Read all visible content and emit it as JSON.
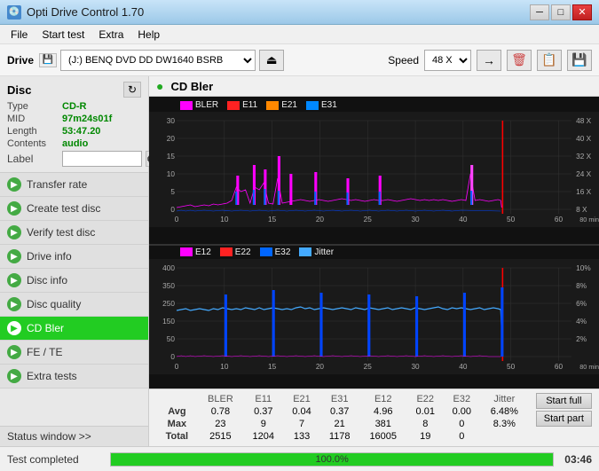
{
  "titleBar": {
    "title": "Opti Drive Control 1.70",
    "icon": "💿"
  },
  "menuBar": {
    "items": [
      "File",
      "Start test",
      "Extra",
      "Help"
    ]
  },
  "toolbar": {
    "driveLabel": "Drive",
    "driveValue": "(J:)  BENQ DVD DD DW1640 BSRB",
    "speedLabel": "Speed",
    "speedValue": "48 X",
    "speedOptions": [
      "8 X",
      "16 X",
      "24 X",
      "32 X",
      "40 X",
      "48 X"
    ]
  },
  "disc": {
    "title": "Disc",
    "type": {
      "key": "Type",
      "value": "CD-R"
    },
    "mid": {
      "key": "MID",
      "value": "97m24s01f"
    },
    "length": {
      "key": "Length",
      "value": "53:47.20"
    },
    "contents": {
      "key": "Contents",
      "value": "audio"
    },
    "label": {
      "key": "Label",
      "value": ""
    }
  },
  "navItems": [
    {
      "id": "transfer-rate",
      "label": "Transfer rate",
      "active": false
    },
    {
      "id": "create-test-disc",
      "label": "Create test disc",
      "active": false
    },
    {
      "id": "verify-test-disc",
      "label": "Verify test disc",
      "active": false
    },
    {
      "id": "drive-info",
      "label": "Drive info",
      "active": false
    },
    {
      "id": "disc-info",
      "label": "Disc info",
      "active": false
    },
    {
      "id": "disc-quality",
      "label": "Disc quality",
      "active": false
    },
    {
      "id": "cd-bler",
      "label": "CD Bler",
      "active": true
    },
    {
      "id": "fe-te",
      "label": "FE / TE",
      "active": false
    },
    {
      "id": "extra-tests",
      "label": "Extra tests",
      "active": false
    }
  ],
  "statusWindow": {
    "label": "Status window >>"
  },
  "chart": {
    "title": "CD Bler",
    "topChart": {
      "legend": [
        {
          "name": "BLER",
          "color": "#ff00ff"
        },
        {
          "name": "E11",
          "color": "#ff2222"
        },
        {
          "name": "E21",
          "color": "#ff8800"
        },
        {
          "name": "E31",
          "color": "#0088ff"
        }
      ]
    },
    "bottomChart": {
      "legend": [
        {
          "name": "E12",
          "color": "#ff00ff"
        },
        {
          "name": "E22",
          "color": "#ff2222"
        },
        {
          "name": "E32",
          "color": "#0066ff"
        },
        {
          "name": "Jitter",
          "color": "#44aaff"
        }
      ]
    }
  },
  "stats": {
    "headers": [
      "",
      "BLER",
      "E11",
      "E21",
      "E31",
      "E12",
      "E22",
      "E32",
      "Jitter"
    ],
    "rows": [
      {
        "label": "Avg",
        "values": [
          "0.78",
          "0.37",
          "0.04",
          "0.37",
          "4.96",
          "0.01",
          "0.00",
          "6.48%"
        ]
      },
      {
        "label": "Max",
        "values": [
          "23",
          "9",
          "7",
          "21",
          "381",
          "8",
          "0",
          "8.3%"
        ]
      },
      {
        "label": "Total",
        "values": [
          "2515",
          "1204",
          "133",
          "1178",
          "16005",
          "19",
          "0",
          ""
        ]
      }
    ],
    "startFull": "Start full",
    "startPart": "Start part"
  },
  "statusBar": {
    "text": "Test completed",
    "progress": 100,
    "progressLabel": "100.0%",
    "time": "03:46"
  }
}
